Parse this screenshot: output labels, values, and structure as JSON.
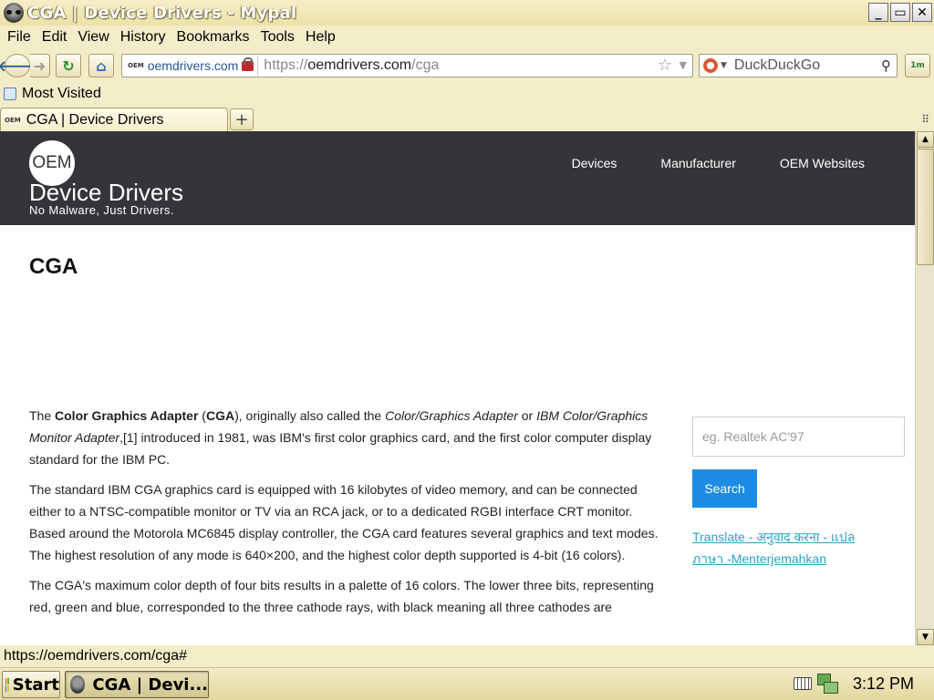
{
  "window": {
    "title": "CGA | Device Drivers - Mypal",
    "controls": {
      "minimize": "_",
      "restore": "▭",
      "close": "✕"
    }
  },
  "menubar": {
    "items": [
      "File",
      "Edit",
      "View",
      "History",
      "Bookmarks",
      "Tools",
      "Help"
    ]
  },
  "navbar": {
    "site_favicon": "OEM",
    "site_domain": "oemdrivers.com",
    "url_scheme": "https://",
    "url_host": "oemdrivers.com",
    "url_path": "/cga",
    "search_placeholder": "DuckDuckGo",
    "extra_button": "1m"
  },
  "bookmarks": {
    "items": [
      "Most Visited"
    ]
  },
  "tabs": {
    "active_favicon": "OEM",
    "active_label": "CGA | Device Drivers",
    "new_tab_symbol": "+"
  },
  "site": {
    "logo_text": "OEM",
    "name": "Device Drivers",
    "tagline": "No Malware, Just Drivers.",
    "nav": [
      "Devices",
      "Manufacturer",
      "OEM Websites"
    ]
  },
  "page": {
    "heading": "CGA",
    "paragraphs": [
      {
        "p1_a": "The ",
        "p1_b": "Color Graphics Adapter",
        "p1_c": " (",
        "p1_d": "CGA",
        "p1_e": "), originally also called the ",
        "p1_f": "Color/Graphics Adapter",
        "p1_g": " or ",
        "p1_h": "IBM Color/Graphics Monitor Adapter",
        "p1_i": ",[1] introduced in 1981, was IBM's first color graphics card, and the first color computer display standard for the IBM PC."
      }
    ],
    "p2": "The standard IBM CGA graphics card is equipped with 16 kilobytes of video memory, and can be connected either to a NTSC-compatible monitor or TV via an RCA jack, or to a dedicated RGBI interface CRT monitor. Based around the Motorola MC6845 display controller, the CGA card features several graphics and text modes. The highest resolution of any mode is 640×200, and the highest color depth supported is 4-bit (16 colors).",
    "p3": "The CGA's maximum color depth of four bits results in a palette of 16 colors. The lower three bits, representing red, green and blue, corresponded to the three cathode rays, with black meaning all three cathodes are"
  },
  "sidebar": {
    "search_placeholder": "eg. Realtek AC'97",
    "search_button": "Search",
    "translate_link": "Translate - अनुवाद करना - แปลภาษา -Menterjemahkan"
  },
  "statusbar": {
    "text": "https://oemdrivers.com/cga#"
  },
  "taskbar": {
    "start_label": "Start",
    "task_label": "CGA | Devi...",
    "clock": "3:12 PM"
  }
}
